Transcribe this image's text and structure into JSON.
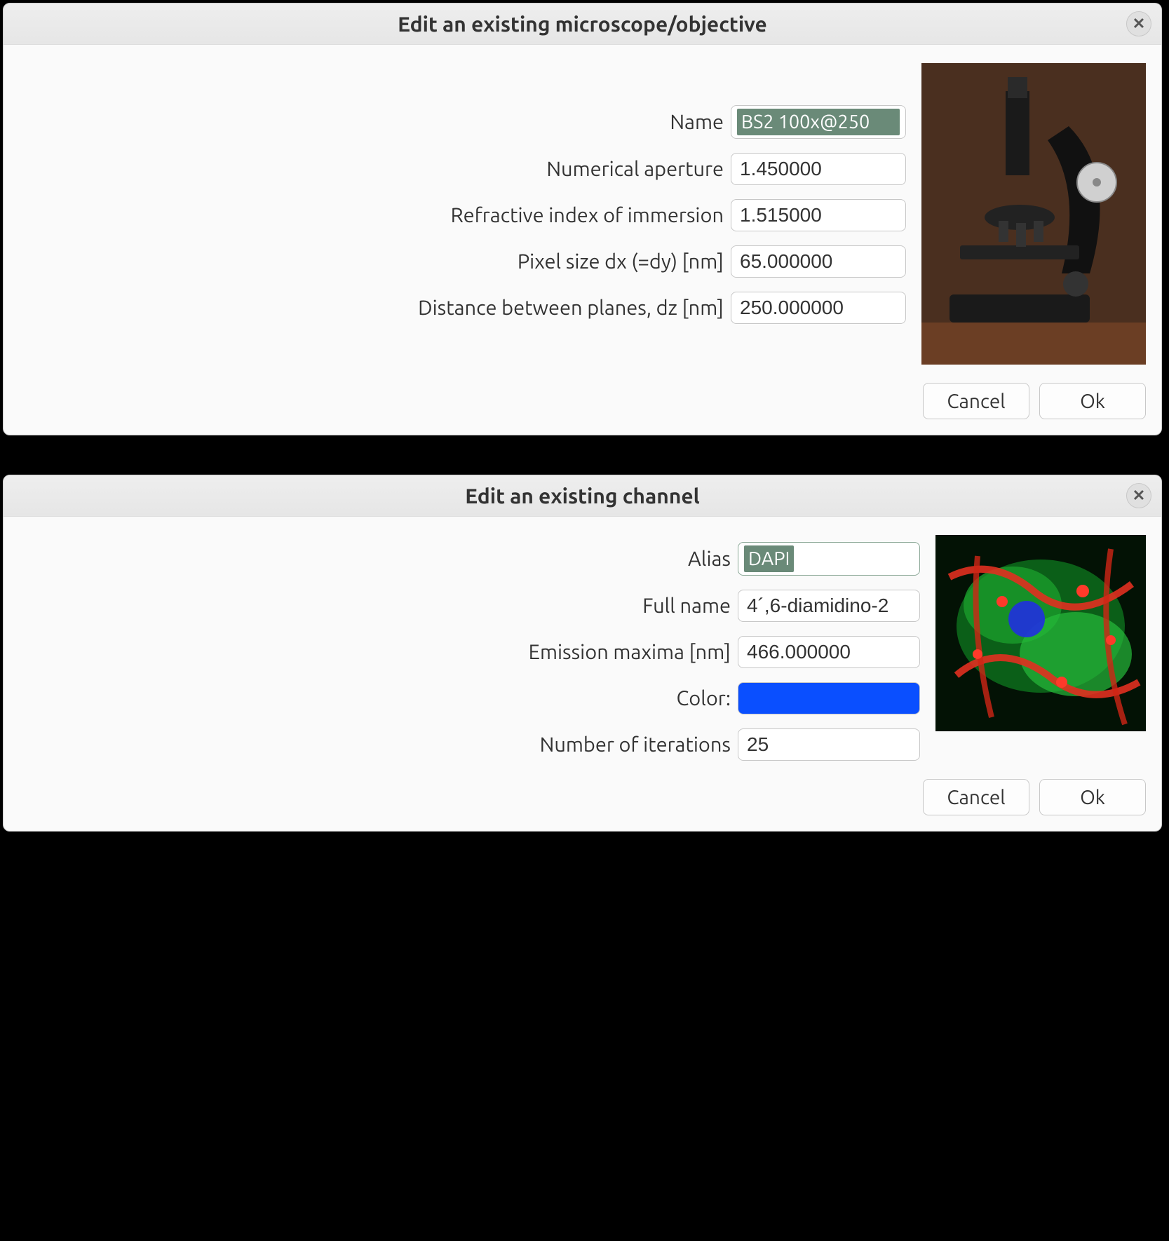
{
  "dialog1": {
    "title": "Edit an existing microscope/objective",
    "fields": {
      "name_label": "Name",
      "name_value": "BS2 100x@250",
      "na_label": "Numerical aperture",
      "na_value": "1.450000",
      "ri_label": "Refractive index of immersion",
      "ri_value": "1.515000",
      "dx_label": "Pixel size dx (=dy) [nm]",
      "dx_value": "65.000000",
      "dz_label": "Distance between planes, dz [nm]",
      "dz_value": "250.000000"
    },
    "cancel": "Cancel",
    "ok": "Ok",
    "thumbnail_desc": "microscope-image"
  },
  "dialog2": {
    "title": "Edit an existing channel",
    "fields": {
      "alias_label": "Alias",
      "alias_value": "DAPI",
      "fullname_label": "Full name",
      "fullname_value": "4´,6-diamidino-2",
      "emission_label": "Emission maxima [nm]",
      "emission_value": "466.000000",
      "color_label": "Color:",
      "color_value": "#0a4fff",
      "iter_label": "Number of iterations",
      "iter_value": "25"
    },
    "cancel": "Cancel",
    "ok": "Ok",
    "thumbnail_desc": "fluorescence-cells-image"
  }
}
